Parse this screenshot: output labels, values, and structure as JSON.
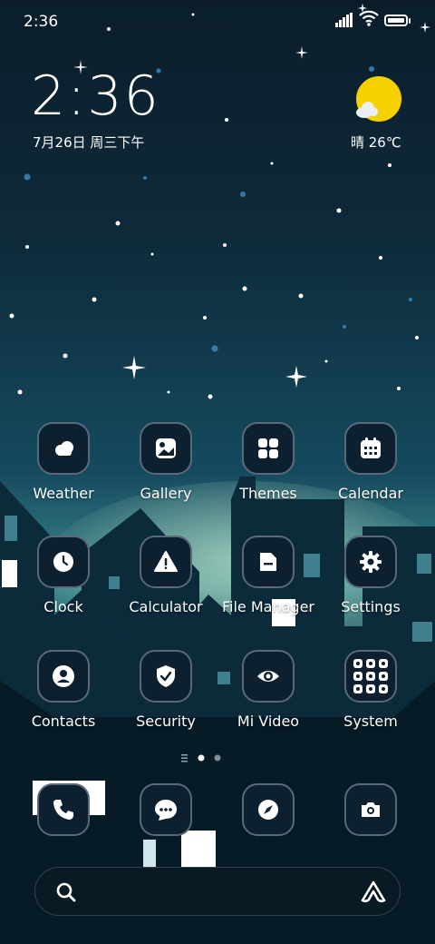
{
  "status_bar": {
    "time": "2:36",
    "battery_icon": "battery-icon",
    "wifi_icon": "wifi-icon",
    "signal_icon": "signal-icon"
  },
  "clock_widget": {
    "time": "2:36",
    "date": "7月26日 周三下午"
  },
  "weather_widget": {
    "icon": "sunny-cloud-icon",
    "text": "晴 26℃"
  },
  "apps": [
    {
      "label": "Weather",
      "icon": "weather-icon"
    },
    {
      "label": "Gallery",
      "icon": "gallery-icon"
    },
    {
      "label": "Themes",
      "icon": "themes-icon"
    },
    {
      "label": "Calendar",
      "icon": "calendar-icon"
    },
    {
      "label": "Clock",
      "icon": "clock-icon"
    },
    {
      "label": "Calculator",
      "icon": "calculator-icon"
    },
    {
      "label": "File Manager",
      "icon": "file-manager-icon"
    },
    {
      "label": "Settings",
      "icon": "settings-icon"
    },
    {
      "label": "Contacts",
      "icon": "contacts-icon"
    },
    {
      "label": "Security",
      "icon": "security-icon"
    },
    {
      "label": "Mi Video",
      "icon": "mi-video-icon"
    },
    {
      "label": "System",
      "icon": "system-folder-icon"
    }
  ],
  "page_indicator": {
    "pages": 2,
    "current": 1
  },
  "dock": [
    {
      "icon": "phone-icon"
    },
    {
      "icon": "messages-icon"
    },
    {
      "icon": "browser-icon"
    },
    {
      "icon": "camera-icon"
    }
  ],
  "search_bar": {
    "icon": "search-icon",
    "assistant_icon": "assistant-icon"
  },
  "colors": {
    "icon_border": "#59697a",
    "icon_fill": "#0d2030",
    "weather_sun": "#f7d000"
  }
}
